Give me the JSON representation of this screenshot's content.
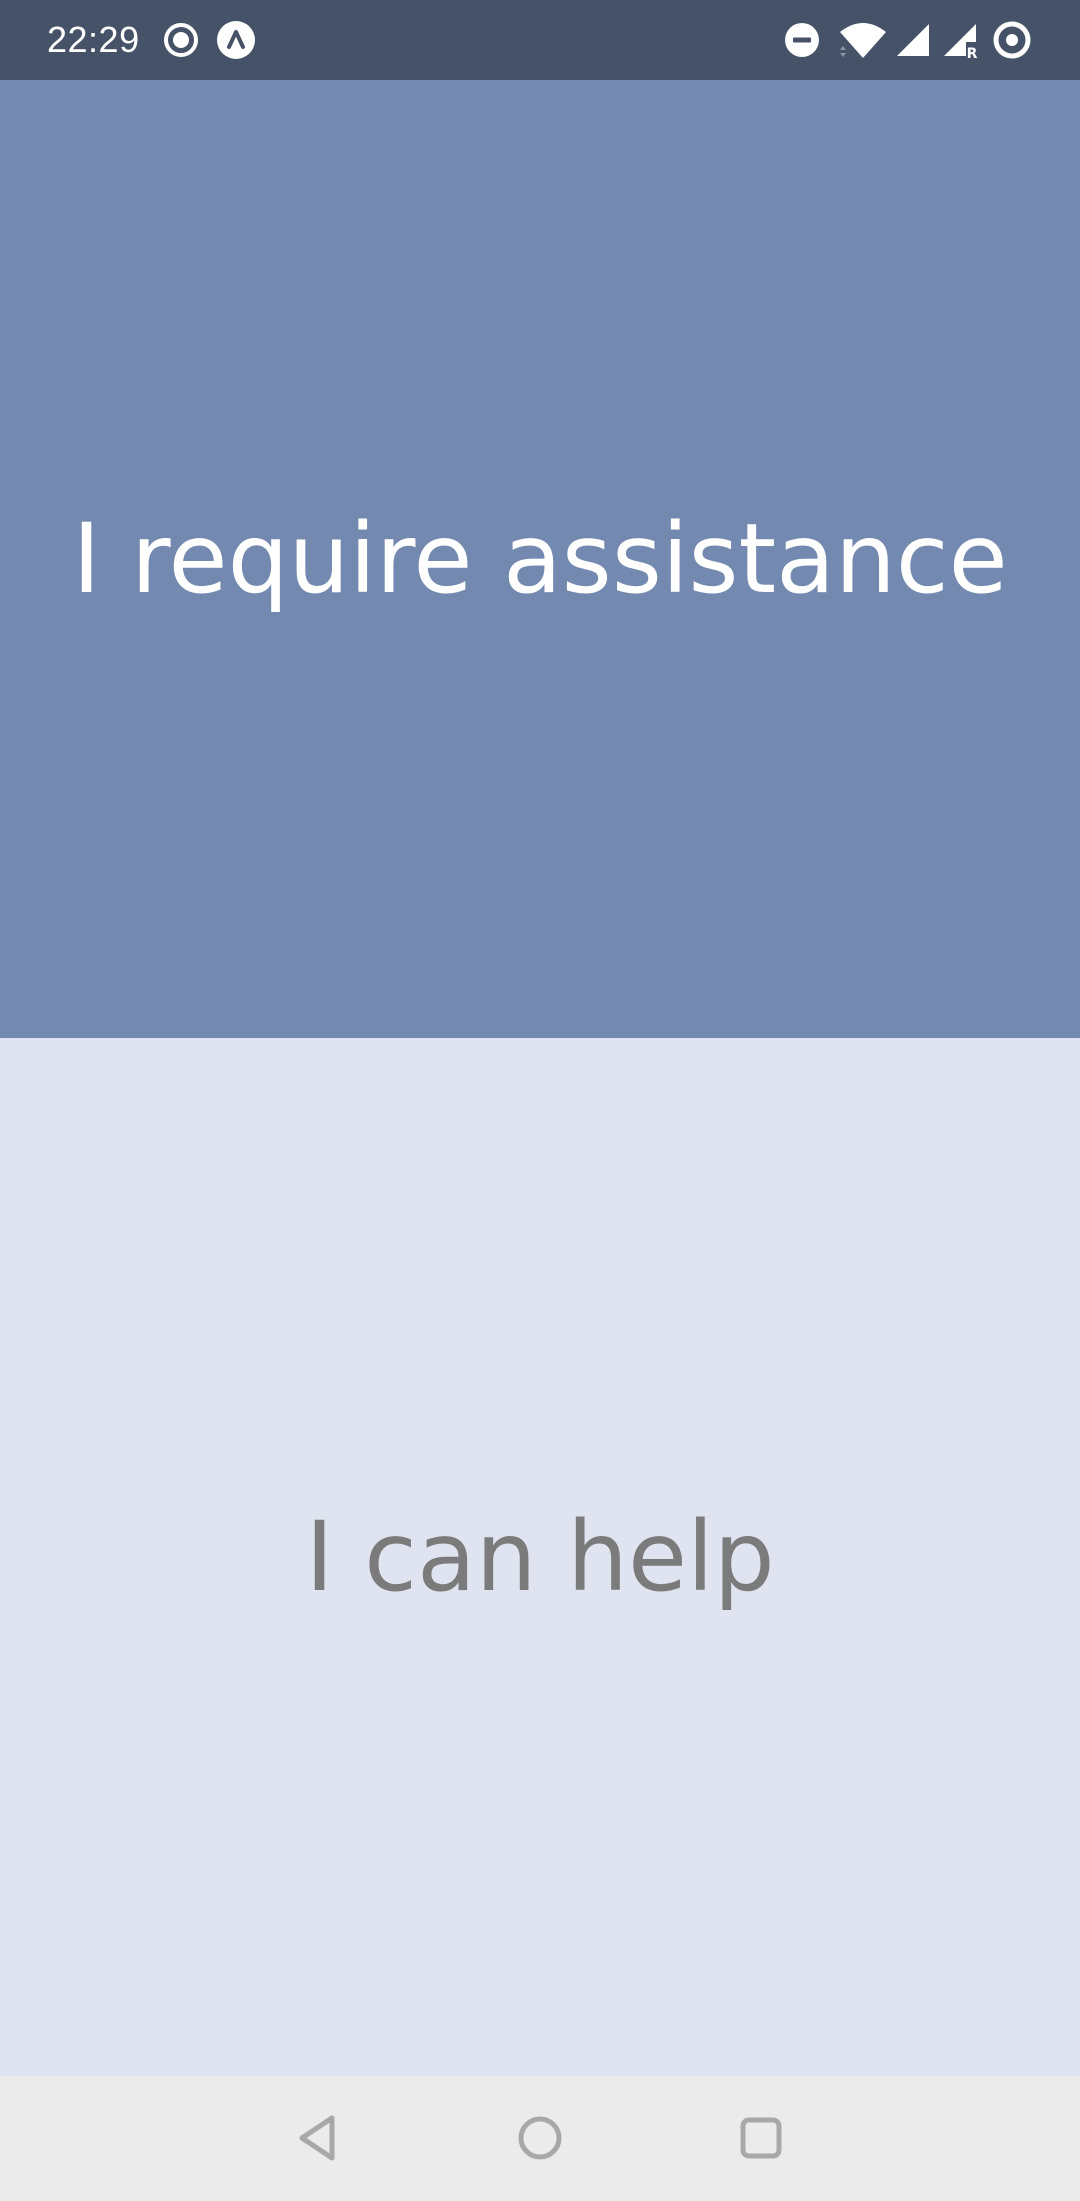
{
  "status_bar": {
    "time": "22:29",
    "left_icons": [
      "record-icon",
      "app-notification-icon"
    ],
    "right_icons": [
      "do-not-disturb-icon",
      "wifi-icon",
      "signal-icon",
      "signal-roaming-icon",
      "hotspot-icon"
    ],
    "roaming_label": "R"
  },
  "panels": {
    "top": {
      "label": "I require assistance",
      "background": "#7489af",
      "text_color": "#ffffff"
    },
    "bottom": {
      "label": "I can help",
      "background": "#e0e4f1",
      "text_color": "#7b7b7b"
    }
  },
  "nav_bar": {
    "buttons": [
      "back-icon",
      "home-icon",
      "recents-icon"
    ]
  },
  "colors": {
    "status_bar": "#465268",
    "nav_bar": "#ebebeb",
    "nav_icon": "#a8a8a8"
  }
}
